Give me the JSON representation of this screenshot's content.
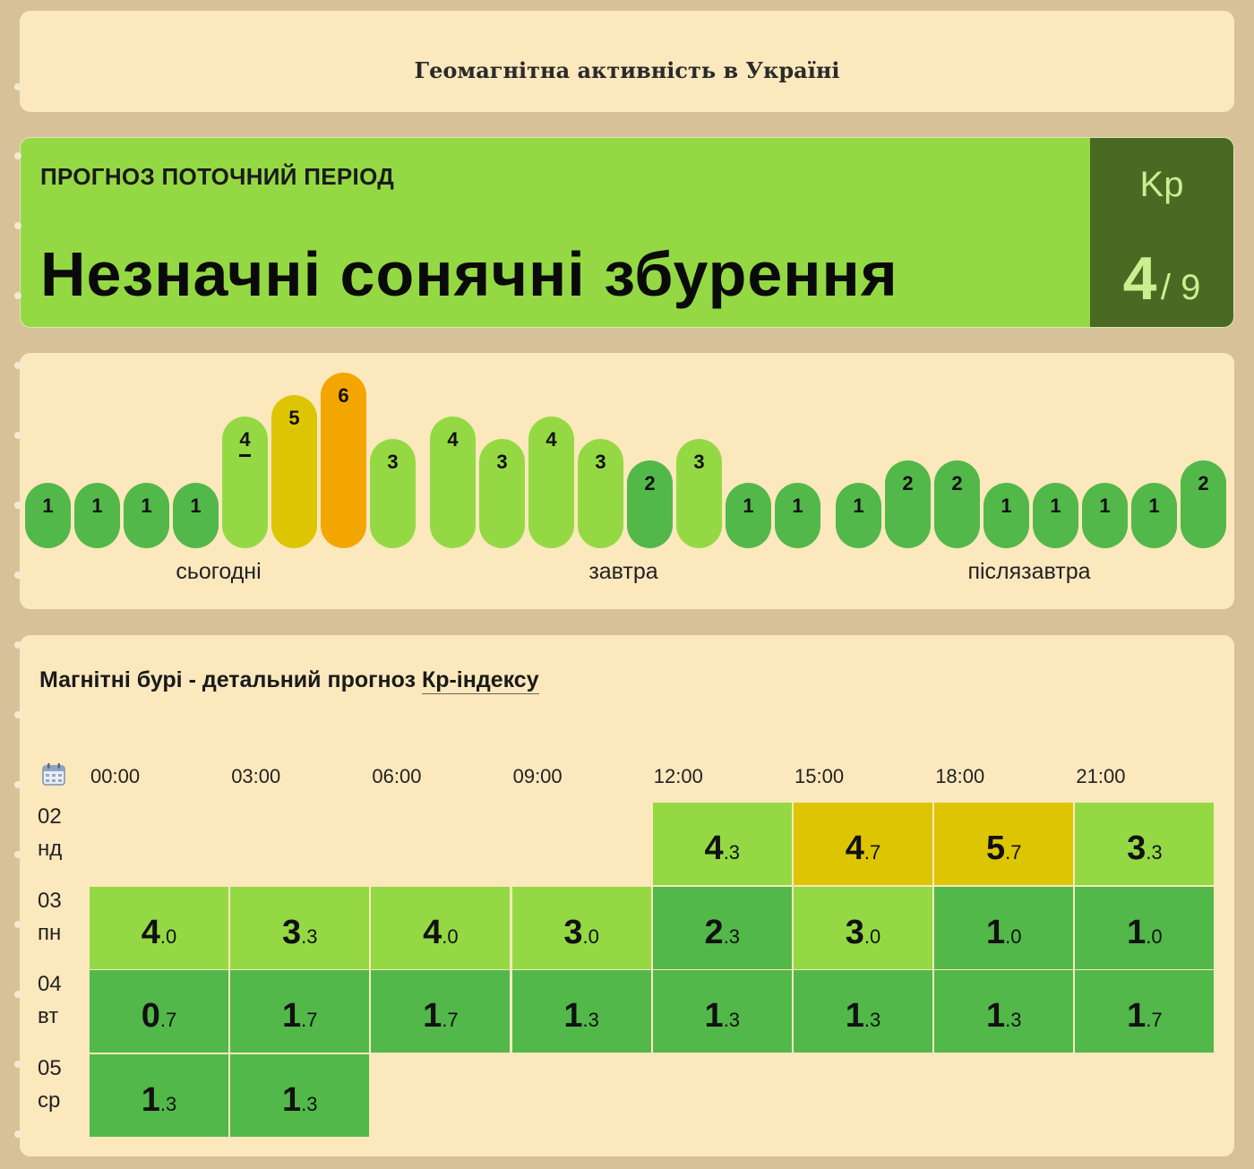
{
  "header": {
    "title": "Геомагнітна активність в Україні"
  },
  "forecast": {
    "period_label": "ПРОГНОЗ ПОТОЧНИЙ ПЕРІОД",
    "headline": "Незначні сонячні збурення",
    "kp_label": "Kp",
    "kp_value": "4",
    "kp_max": "/ 9"
  },
  "colors": {
    "green": "#52b84a",
    "light_green": "#94d944",
    "yellow": "#dec503",
    "orange": "#f4a600",
    "card_bg": "#fce8bd",
    "page_bg": "#d6c199",
    "kp_box": "#4a6922"
  },
  "bars": {
    "days": [
      {
        "label": "сьогодні",
        "values": [
          1,
          1,
          1,
          1,
          4,
          5,
          6,
          3
        ],
        "current_index": 4
      },
      {
        "label": "завтра",
        "values": [
          4,
          3,
          4,
          3,
          2,
          3,
          1,
          1
        ]
      },
      {
        "label": "післязавтра",
        "values": [
          1,
          2,
          2,
          1,
          1,
          1,
          1,
          2
        ]
      }
    ]
  },
  "table": {
    "title_prefix": "Магнітні бурі - детальний прогноз ",
    "title_link": "Кр-індексу",
    "calendar_icon": "calendar-icon",
    "times": [
      "00:00",
      "03:00",
      "06:00",
      "09:00",
      "12:00",
      "15:00",
      "18:00",
      "21:00"
    ],
    "rows": [
      {
        "date": "02",
        "weekday": "нд",
        "start": 4,
        "values": [
          "4.3",
          "4.7",
          "5.7",
          "3.3"
        ]
      },
      {
        "date": "03",
        "weekday": "пн",
        "start": 0,
        "values": [
          "4.0",
          "3.3",
          "4.0",
          "3.0",
          "2.3",
          "3.0",
          "1.0",
          "1.0"
        ]
      },
      {
        "date": "04",
        "weekday": "вт",
        "start": 0,
        "values": [
          "0.7",
          "1.7",
          "1.7",
          "1.3",
          "1.3",
          "1.3",
          "1.3",
          "1.7"
        ]
      },
      {
        "date": "05",
        "weekday": "ср",
        "start": 0,
        "values": [
          "1.3",
          "1.3"
        ]
      }
    ]
  }
}
